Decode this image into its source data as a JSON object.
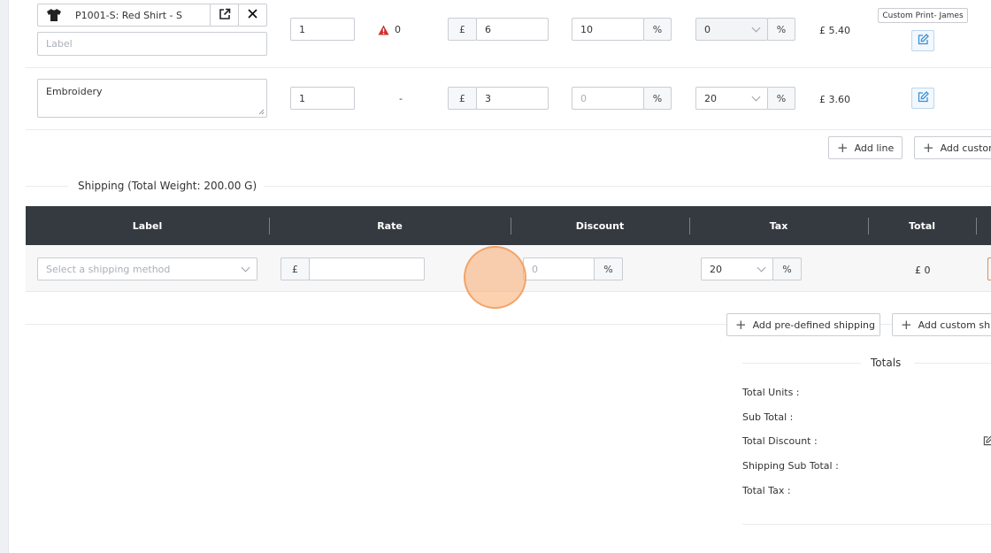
{
  "line_items": [
    {
      "product_name": "P1001-S: Red Shirt - S",
      "label_placeholder": "Label",
      "quantity": "1",
      "stock_count": "0",
      "currency": "£",
      "price": "6",
      "discount": "10",
      "percent": "%",
      "tax": "0",
      "total": "£ 5.40",
      "badge": "Custom Print- James"
    },
    {
      "label_value": "Embroidery",
      "quantity": "1",
      "stock_dash": "-",
      "currency": "£",
      "price": "3",
      "discount_placeholder": "0",
      "percent": "%",
      "tax": "20",
      "total": "£ 3.60"
    }
  ],
  "line_actions": {
    "add_line": "Add line",
    "add_custom": "Add custom"
  },
  "shipping": {
    "title": "Shipping (Total Weight: 200.00 G)",
    "columns": [
      "Label",
      "Rate",
      "Discount",
      "Tax",
      "Total"
    ],
    "row": {
      "method_placeholder": "Select a shipping method",
      "currency": "£",
      "discount_placeholder": "0",
      "percent": "%",
      "tax": "20",
      "total": "£ 0"
    },
    "add_predefined": "Add pre-defined shipping",
    "add_custom": "Add custom shipping"
  },
  "totals": {
    "title": "Totals",
    "labels": [
      "Total Units :",
      "Sub Total :",
      "Total Discount :",
      "Shipping Sub Total :",
      "Total Tax :"
    ]
  },
  "icons": {
    "shirt": "shirt-icon",
    "external": "external-link-icon",
    "close": "close-icon",
    "warning": "warning-icon",
    "edit": "edit-icon",
    "plus": "plus-icon",
    "chevron": "chevron-down-icon"
  },
  "colors": {
    "header_bg": "#343a40",
    "edit_icon": "#3a8fd6",
    "warning": "#d0312d",
    "click_indicator": "#f8ac70"
  }
}
